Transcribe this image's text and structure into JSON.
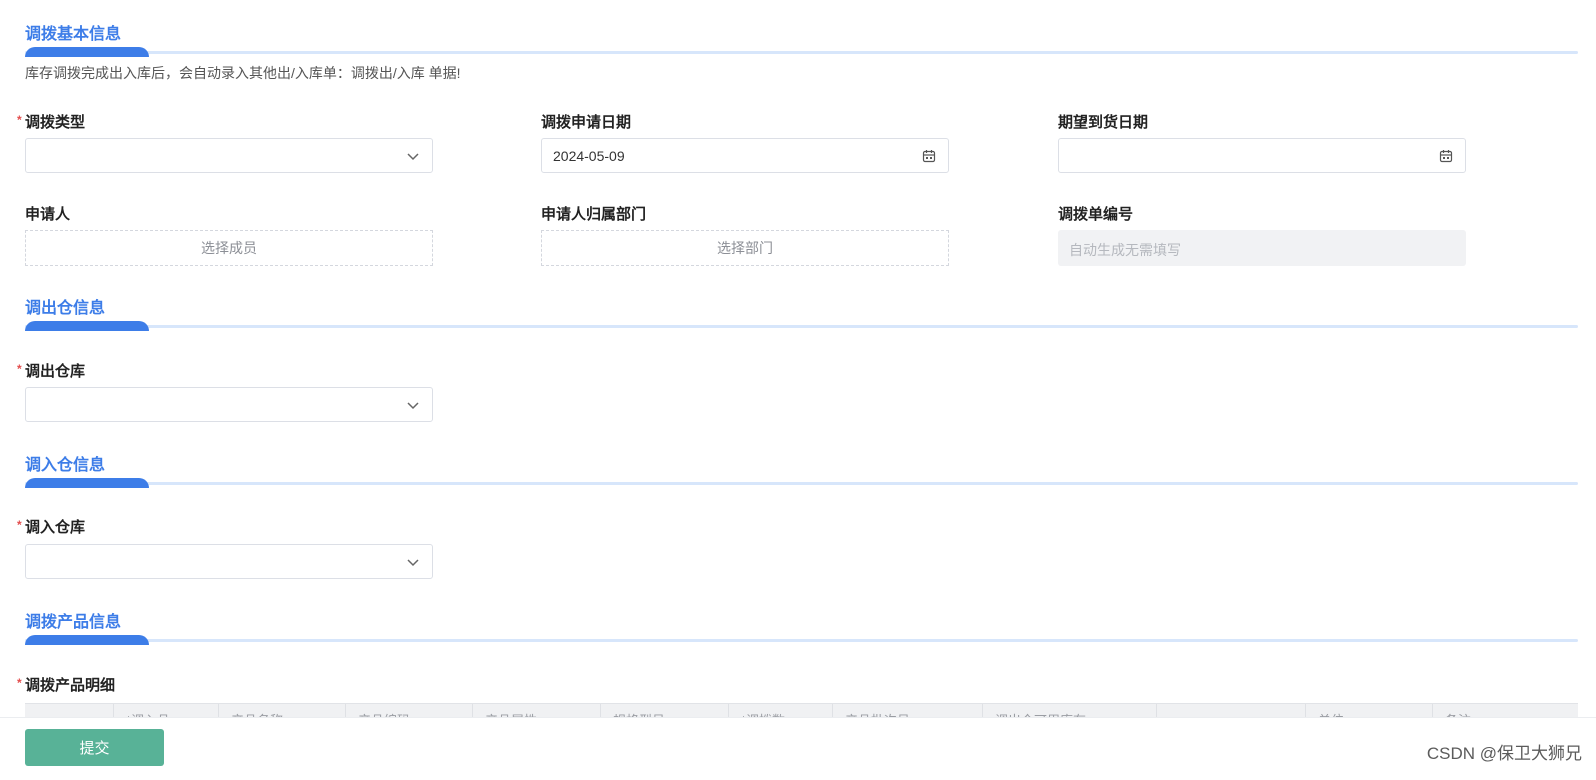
{
  "sections": {
    "basic": {
      "title": "调拨基本信息"
    },
    "out": {
      "title": "调出仓信息"
    },
    "in": {
      "title": "调入仓信息"
    },
    "products": {
      "title": "调拨产品信息"
    }
  },
  "notice": "库存调拨完成出入库后，会自动录入其他出/入库单：调拨出/入库 单据!",
  "fields": {
    "transfer_type": {
      "label": "调拨类型",
      "required": true,
      "value": "",
      "icon": "chevron-down-icon"
    },
    "apply_date": {
      "label": "调拨申请日期",
      "value": "2024-05-09",
      "icon": "calendar-icon"
    },
    "expected_date": {
      "label": "期望到货日期",
      "value": "",
      "icon": "calendar-icon"
    },
    "applicant": {
      "label": "申请人",
      "placeholder": "选择成员"
    },
    "department": {
      "label": "申请人归属部门",
      "placeholder": "选择部门"
    },
    "order_no": {
      "label": "调拨单编号",
      "placeholder": "自动生成无需填写"
    },
    "out_warehouse": {
      "label": "调出仓库",
      "required": true,
      "value": "",
      "icon": "chevron-down-icon"
    },
    "in_warehouse": {
      "label": "调入仓库",
      "required": true,
      "value": "",
      "icon": "chevron-down-icon"
    },
    "product_detail": {
      "label": "调拨产品明细",
      "required": true
    }
  },
  "required_mark": "*",
  "table": {
    "columns": [
      "",
      "*调入品",
      "产品名称",
      "产品编码",
      "产品属性",
      "规格型号",
      "*调拨数",
      "产品批次号",
      "调出仓可用库存",
      "",
      "单位",
      "备注"
    ]
  },
  "submit_label": "提交",
  "watermark": "CSDN @保卫大狮兄",
  "colors": {
    "accent": "#3d7de8",
    "required": "#e34d4d",
    "submit": "#58b297"
  }
}
